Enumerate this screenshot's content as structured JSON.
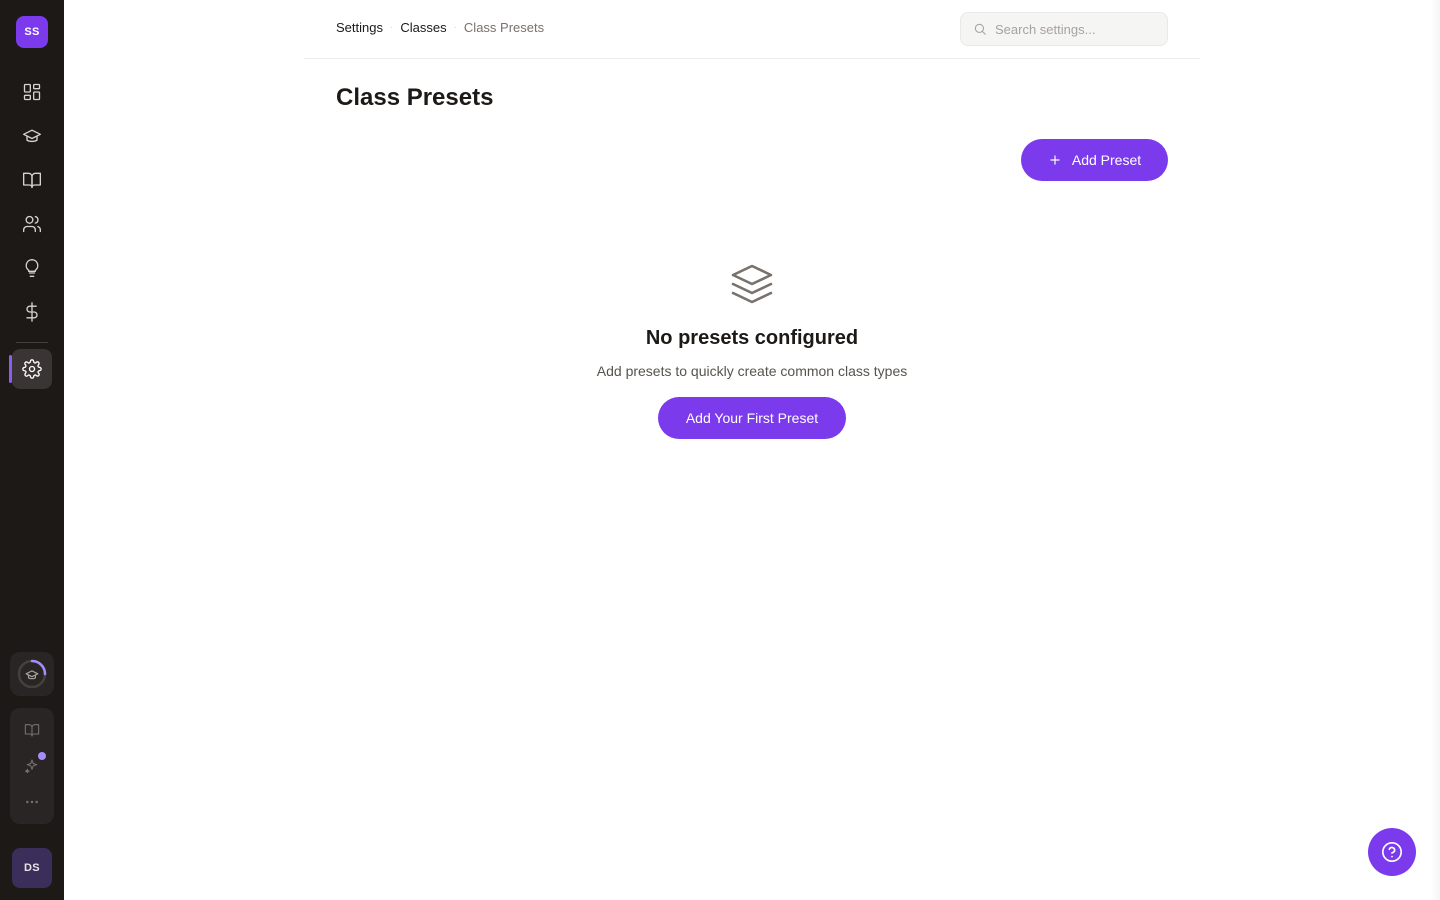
{
  "sidebar": {
    "org_avatar": "SS",
    "user_avatar": "DS",
    "nav": [
      {
        "icon": "dashboard-icon"
      },
      {
        "icon": "graduation-cap-icon"
      },
      {
        "icon": "book-open-icon"
      },
      {
        "icon": "users-icon"
      },
      {
        "icon": "lightbulb-icon"
      },
      {
        "icon": "dollar-icon"
      },
      {
        "icon": "gear-icon",
        "active": true
      }
    ],
    "tools": [
      "book-icon",
      "sparkles-icon",
      "more-icon"
    ],
    "accent": "#7c3aed"
  },
  "header": {
    "breadcrumb": [
      "Settings",
      "Classes",
      "Class Presets"
    ],
    "search_placeholder": "Search settings..."
  },
  "page": {
    "title": "Class Presets",
    "add_button": "Add Preset"
  },
  "empty_state": {
    "icon": "layers-icon",
    "title": "No presets configured",
    "description": "Add presets to quickly create common class types",
    "button": "Add Your First Preset"
  },
  "help": {
    "icon": "help-circle-icon"
  }
}
